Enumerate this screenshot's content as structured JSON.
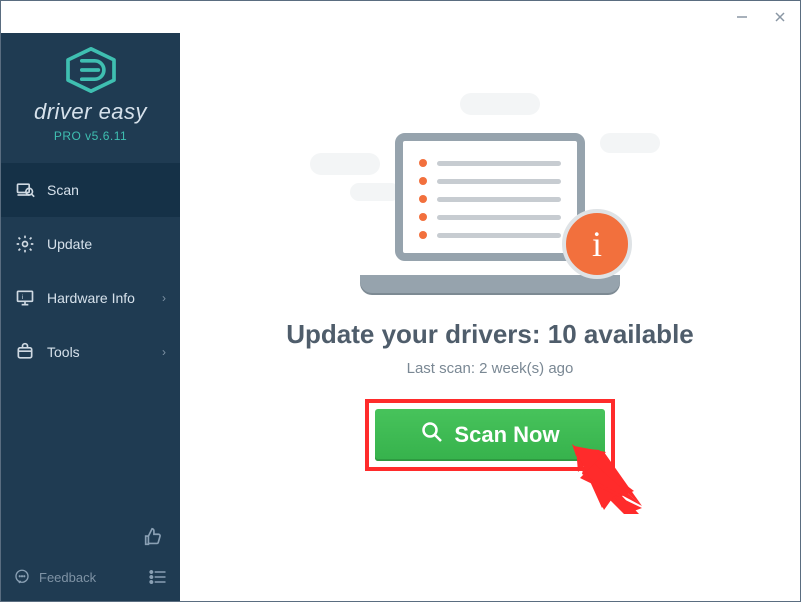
{
  "app": {
    "name": "driver easy",
    "edition": "PRO",
    "version": "5.6.11",
    "version_label": "PRO v5.6.11"
  },
  "sidebar": {
    "items": [
      {
        "label": "Scan",
        "icon": "scan",
        "has_sub": false,
        "active": true
      },
      {
        "label": "Update",
        "icon": "gear",
        "has_sub": false,
        "active": false
      },
      {
        "label": "Hardware Info",
        "icon": "monitor",
        "has_sub": true,
        "active": false
      },
      {
        "label": "Tools",
        "icon": "tools",
        "has_sub": true,
        "active": false
      }
    ],
    "feedback_label": "Feedback"
  },
  "main": {
    "headline_prefix": "Update your drivers: ",
    "available_count": 10,
    "headline_suffix": " available",
    "last_scan_prefix": "Last scan: ",
    "last_scan_value": "2 week(s) ago",
    "scan_button_label": "Scan Now"
  },
  "colors": {
    "sidebar_bg": "#1f3b52",
    "accent_teal": "#3fbfb1",
    "accent_orange": "#f2703d",
    "scan_green": "#3fba53",
    "callout_red": "#ff2b2b"
  }
}
